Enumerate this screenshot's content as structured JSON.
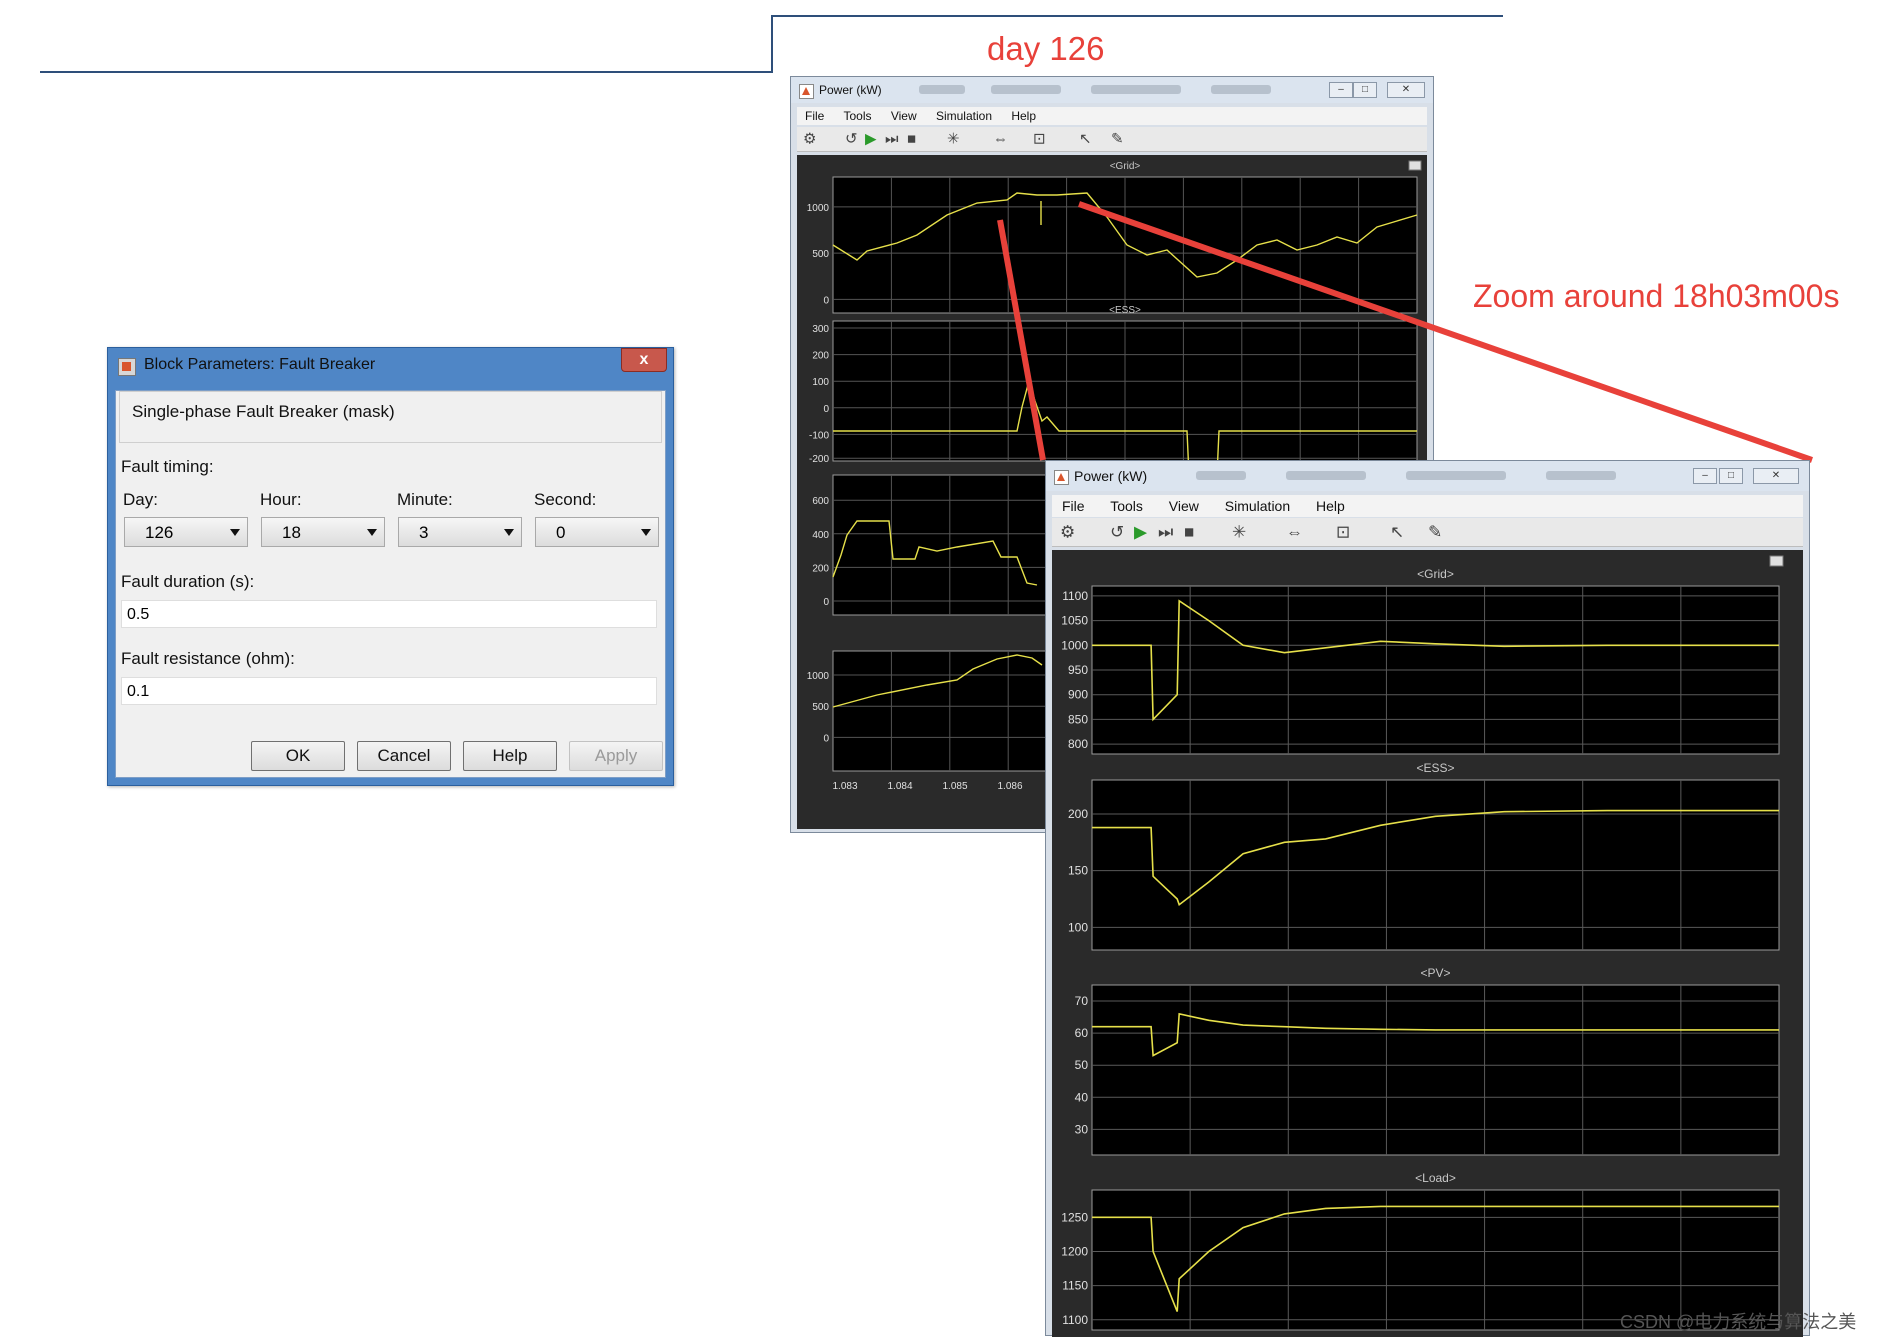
{
  "annotations": {
    "day_label": "day 126",
    "zoom_label": "Zoom around 18h03m00s",
    "watermark": "CSDN @电力系统与算法之美",
    "line_color": "#e8413a"
  },
  "dialog": {
    "title": "Block Parameters: Fault Breaker",
    "close_glyph": "x",
    "mask_text": "Single-phase Fault Breaker (mask)",
    "fault_timing_label": "Fault timing:",
    "fields": [
      {
        "label": "Day:",
        "value": "126"
      },
      {
        "label": "Hour:",
        "value": "18"
      },
      {
        "label": "Minute:",
        "value": "3"
      },
      {
        "label": "Second:",
        "value": "0"
      }
    ],
    "duration_label": "Fault duration (s):",
    "duration_value": "0.5",
    "resistance_label": "Fault resistance (ohm):",
    "resistance_value": "0.1",
    "buttons": {
      "ok": "OK",
      "cancel": "Cancel",
      "help": "Help",
      "apply": "Apply"
    }
  },
  "scope_back": {
    "title": "Power (kW)",
    "menu": [
      "File",
      "Tools",
      "View",
      "Simulation",
      "Help"
    ],
    "plots": [
      {
        "title": "<Grid>",
        "yticks": [
          "1000",
          "500",
          "0"
        ]
      },
      {
        "title": "<ESS>",
        "yticks": [
          "300",
          "200",
          "100",
          "0",
          "-100",
          "-200"
        ]
      },
      {
        "title": "",
        "yticks": [
          "600",
          "400",
          "200",
          "0"
        ]
      },
      {
        "title": "",
        "yticks": [
          "1000",
          "500",
          "0"
        ]
      }
    ],
    "xticks": [
      "1.083",
      "1.084",
      "1.085",
      "1.086"
    ]
  },
  "scope_front": {
    "title": "Power (kW)",
    "menu": [
      "File",
      "Tools",
      "View",
      "Simulation",
      "Help"
    ],
    "plots": [
      {
        "title": "<Grid>",
        "yticks": [
          "1100",
          "1050",
          "1000",
          "950",
          "900",
          "850",
          "800"
        ]
      },
      {
        "title": "<ESS>",
        "yticks": [
          "200",
          "150",
          "100"
        ]
      },
      {
        "title": "<PV>",
        "yticks": [
          "70",
          "60",
          "50",
          "40",
          "30"
        ]
      },
      {
        "title": "<Load>",
        "yticks": [
          "1250",
          "1200",
          "1150",
          "1100"
        ]
      }
    ]
  },
  "chart_data": [
    {
      "type": "line",
      "title": "<Grid>",
      "description_note": "zoomed",
      "ylim": [
        780,
        1120
      ],
      "series": [
        {
          "values": [
            1000,
            1000,
            1000,
            850,
            900,
            1090,
            1050,
            1000,
            985,
            995,
            1008,
            1003,
            998,
            1000,
            1000,
            1000
          ]
        }
      ],
      "grid": true
    },
    {
      "type": "line",
      "title": "<ESS>",
      "ylim": [
        80,
        230
      ],
      "series": [
        {
          "values": [
            188,
            188,
            188,
            145,
            125,
            120,
            140,
            165,
            175,
            178,
            190,
            198,
            202,
            203,
            203,
            203
          ]
        }
      ],
      "grid": true
    },
    {
      "type": "line",
      "title": "<PV>",
      "ylim": [
        22,
        75
      ],
      "series": [
        {
          "values": [
            62,
            62,
            62,
            53,
            57,
            66,
            64,
            62.5,
            62,
            61.5,
            61.2,
            61,
            61,
            61,
            61,
            61
          ]
        }
      ],
      "grid": true
    },
    {
      "type": "line",
      "title": "<Load>",
      "ylim": [
        1085,
        1290
      ],
      "series": [
        {
          "values": [
            1250,
            1250,
            1250,
            1200,
            1112,
            1160,
            1200,
            1235,
            1255,
            1263,
            1266,
            1266,
            1266,
            1266,
            1266,
            1266
          ]
        }
      ],
      "grid": true
    }
  ]
}
